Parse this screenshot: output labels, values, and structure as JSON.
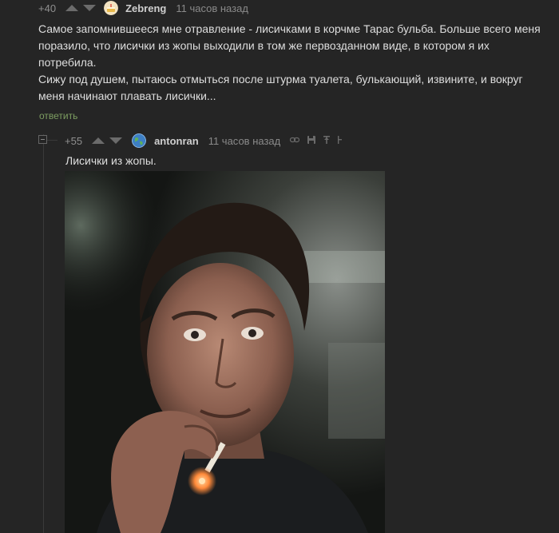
{
  "comments": [
    {
      "rating": "+40",
      "username": "Zebreng",
      "timestamp": "11 часов назад",
      "avatar_icon": "cake-avatar-icon",
      "paragraphs": [
        "Самое запомнившееся мне отравление - лисичками в корчме Тарас бульба. Больше всего меня поразило, что лисички из жопы выходили в том же первозданном виде, в котором я их потребила.",
        "Сижу под душем, пытаюсь отмыться после штурма туалета, булькающий, извините, и вокруг меня начинают плавать лисички..."
      ],
      "reply_label": "ответить"
    },
    {
      "rating": "+55",
      "username": "antonran",
      "timestamp": "11 часов назад",
      "avatar_icon": "globe-avatar-icon",
      "text": "Лисички из жопы.",
      "image_icon": "smoking-man-photo"
    }
  ],
  "colors": {
    "background": "#252525",
    "text": "#dedede",
    "reply_link": "#7d9e61",
    "muted": "#8a8a8a"
  }
}
